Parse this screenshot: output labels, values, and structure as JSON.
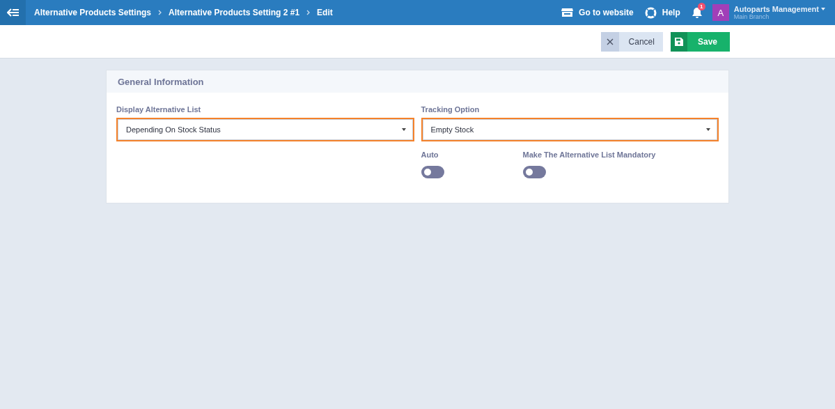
{
  "header": {
    "breadcrumbs": [
      "Alternative Products Settings",
      "Alternative Products Setting 2 #1",
      "Edit"
    ],
    "links": [
      "Go to website",
      "Help"
    ],
    "notifications": "1",
    "account": {
      "initial": "A",
      "name": "Autoparts Management",
      "branch": "Main Branch"
    }
  },
  "toolbar": {
    "buttons": [
      {
        "label": "Cancel",
        "kind": "cancel"
      },
      {
        "label": "Save",
        "kind": "save"
      }
    ]
  },
  "card": {
    "title": "General Information",
    "selects": [
      {
        "label": "Display Alternative List",
        "value": "Depending On Stock Status",
        "highlighted": true
      },
      {
        "label": "Tracking Option",
        "value": "Empty Stock",
        "highlighted": true
      }
    ],
    "toggles": [
      {
        "label": "Auto",
        "on": false
      },
      {
        "label": "Make The Alternative List Mandatory",
        "on": false
      }
    ]
  }
}
